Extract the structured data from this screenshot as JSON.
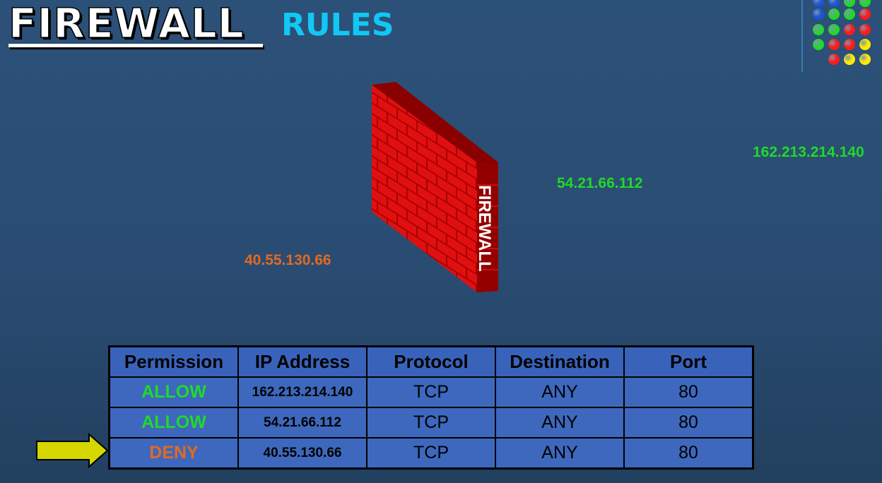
{
  "title": {
    "main": "FIREWALL",
    "sub": "RULES"
  },
  "wall_label": "FIREWALL",
  "ips": {
    "far_right": "162.213.214.140",
    "middle_right": "54.21.66.112",
    "left": "40.55.130.66"
  },
  "colors": {
    "allow": "#22d82a",
    "deny": "#e26a21",
    "title_sub": "#11c8f5",
    "brick": "#d40000",
    "arrow": "#d6d600"
  },
  "table": {
    "headers": [
      "Permission",
      "IP Address",
      "Protocol",
      "Destination",
      "Port"
    ],
    "rows": [
      {
        "permission": "ALLOW",
        "ip": "162.213.214.140",
        "protocol": "TCP",
        "destination": "ANY",
        "port": "80"
      },
      {
        "permission": "ALLOW",
        "ip": "54.21.66.112",
        "protocol": "TCP",
        "destination": "ANY",
        "port": "80"
      },
      {
        "permission": "DENY",
        "ip": "40.55.130.66",
        "protocol": "TCP",
        "destination": "ANY",
        "port": "80"
      }
    ]
  },
  "decor": {
    "dot_grid": "colored-dots",
    "pointer": "yellow-arrow-icon"
  }
}
